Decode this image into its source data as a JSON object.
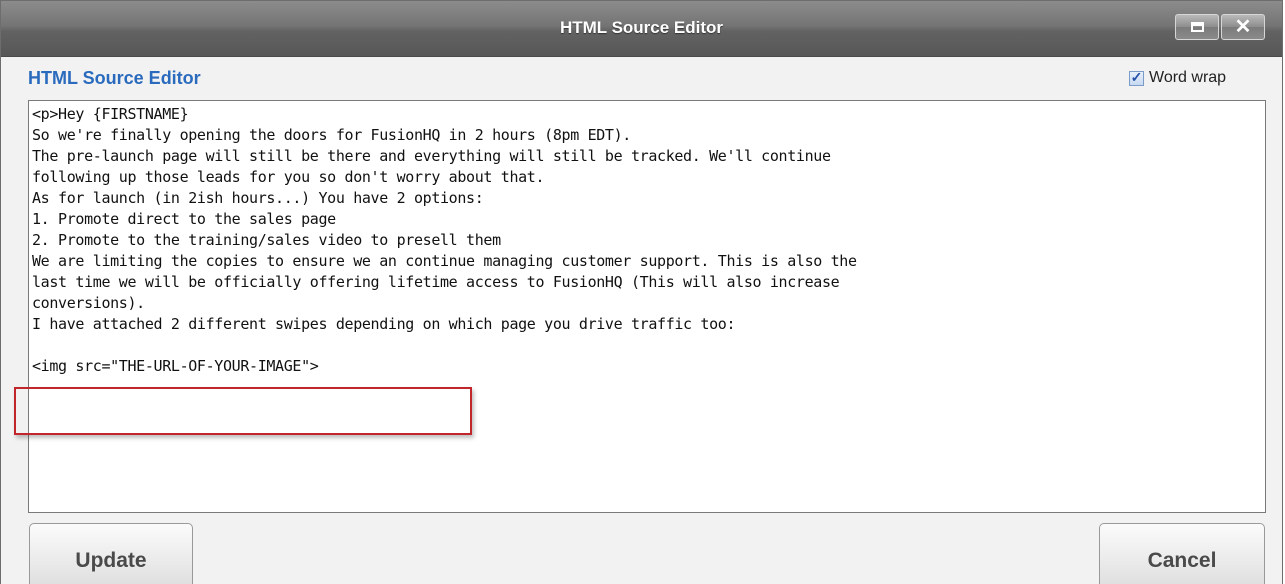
{
  "window": {
    "title": "HTML Source Editor"
  },
  "editor": {
    "heading": "HTML Source Editor",
    "word_wrap_label": "Word wrap",
    "word_wrap_checked": true,
    "lines": [
      "<p>Hey {FIRSTNAME}",
      "So we're finally opening the doors for FusionHQ in 2 hours (8pm EDT).",
      "The pre-launch page will still be there and everything will still be tracked. We'll continue",
      "following up those leads for you so don't worry about that.",
      "As for launch (in 2ish hours...) You have 2 options:",
      "1. Promote direct to the sales page",
      "2. Promote to the training/sales video to presell them",
      "We are limiting the copies to ensure we an continue managing customer support. This is also the",
      "last time we will be officially offering lifetime access to FusionHQ (This will also increase",
      "conversions).",
      "I have attached 2 different swipes depending on which page you drive traffic too:",
      "",
      "<img src=\"THE-URL-OF-YOUR-IMAGE\">"
    ]
  },
  "buttons": {
    "update": "Update",
    "cancel": "Cancel"
  },
  "colors": {
    "heading": "#2a6bbd",
    "highlight_border": "#c0262c"
  },
  "icons": {
    "maximize": "maximize-icon",
    "close": "close-icon",
    "checkbox": "checkmark-icon"
  }
}
